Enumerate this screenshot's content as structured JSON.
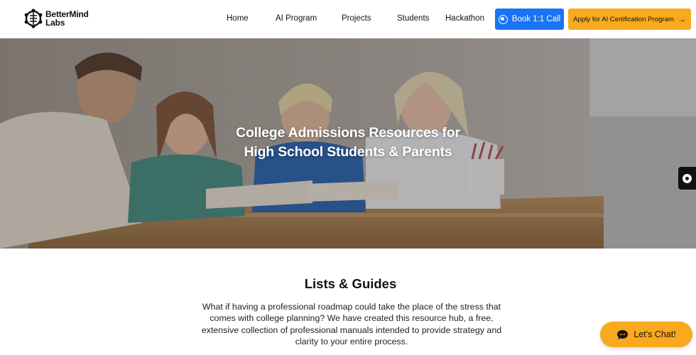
{
  "brand": {
    "name_line1": "BetterMind",
    "name_line2": "Labs"
  },
  "nav": {
    "items": [
      {
        "label": "Home"
      },
      {
        "label": "AI Program"
      },
      {
        "label": "Projects"
      },
      {
        "label": "Students"
      },
      {
        "label": "Hackathon"
      }
    ],
    "book_label": "Book 1:1 Call",
    "apply_label": "Apply for AI Certification Program",
    "apply_arrow": "→"
  },
  "hero": {
    "title_line1": "College Admissions Resources for",
    "title_line2": "High School Students & Parents"
  },
  "guides": {
    "title": "Lists & Guides",
    "body": "What if having a professional roadmap could take the place of the stress that comes with college planning? We have created this resource hub, a free, extensive collection of professional manuals intended to provide strategy and clarity to your entire process."
  },
  "chat": {
    "label": "Let's Chat!"
  },
  "colors": {
    "primary_blue": "#1a73f5",
    "accent_orange": "#f9a91e"
  }
}
